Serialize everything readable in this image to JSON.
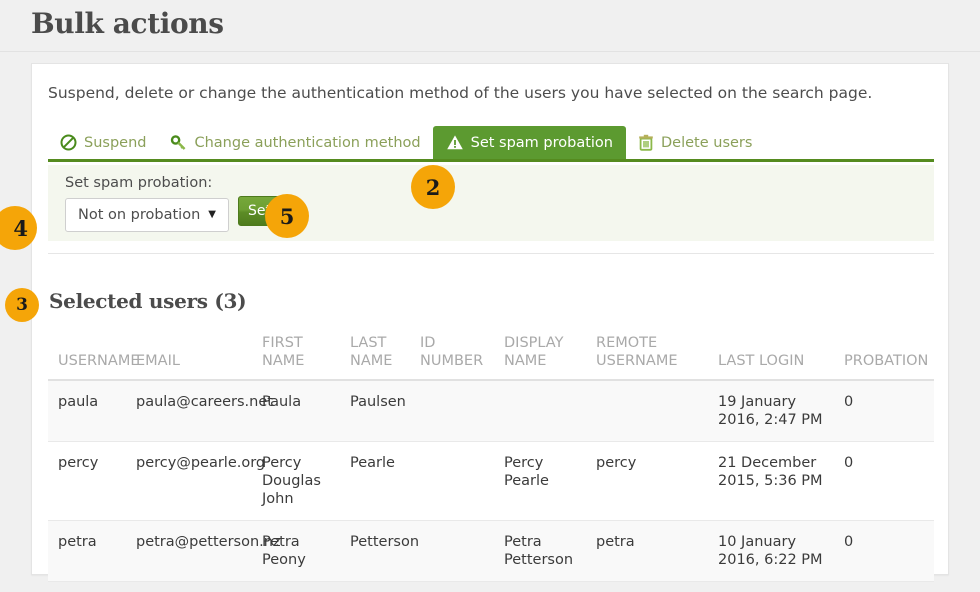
{
  "page": {
    "title": "Bulk actions"
  },
  "card": {
    "intro": "Suspend, delete or change the authentication method of the users you have selected on the search page."
  },
  "tabs": [
    {
      "label": "Suspend",
      "icon": "ban-icon",
      "active": false
    },
    {
      "label": "Change authentication method",
      "icon": "key-icon",
      "active": false
    },
    {
      "label": "Set spam probation",
      "icon": "warning-triangle-icon",
      "active": true
    },
    {
      "label": "Delete users",
      "icon": "trash-icon",
      "active": false
    }
  ],
  "form": {
    "label": "Set spam probation:",
    "select_value": "Not on probation",
    "select_options": [
      "Not on probation"
    ],
    "submit_label": "Set"
  },
  "selected_users": {
    "heading": "Selected users (3)",
    "columns": [
      "USERNAME",
      "EMAIL",
      "FIRST NAME",
      "LAST NAME",
      "ID NUMBER",
      "DISPLAY NAME",
      "REMOTE USERNAME",
      "LAST LOGIN",
      "PROBATION"
    ],
    "rows": [
      {
        "username": "paula",
        "email": "paula@careers.net",
        "first_name": "Paula",
        "last_name": "Paulsen",
        "id_number": "",
        "display_name": "",
        "remote_username": "",
        "last_login": "19 January 2016, 2:47 PM",
        "probation": "0"
      },
      {
        "username": "percy",
        "email": "percy@pearle.org",
        "first_name": "Percy Douglas John",
        "last_name": "Pearle",
        "id_number": "",
        "display_name": "Percy Pearle",
        "remote_username": "percy",
        "last_login": "21 December 2015, 5:36 PM",
        "probation": "0"
      },
      {
        "username": "petra",
        "email": "petra@petterson.nz",
        "first_name": "Petra Peony",
        "last_name": "Petterson",
        "id_number": "",
        "display_name": "Petra Petterson",
        "remote_username": "petra",
        "last_login": "10 January 2016, 6:22 PM",
        "probation": "0"
      }
    ]
  },
  "callouts": [
    {
      "number": "2"
    },
    {
      "number": "3"
    },
    {
      "number": "4"
    },
    {
      "number": "5"
    }
  ],
  "colors": {
    "accent_green": "#558b1f",
    "tab_active_bg": "#5c9a30",
    "tab_inactive_text": "#8ba05a",
    "strip_bg": "#f4f7ee",
    "badge_orange": "#f5a508",
    "page_bg": "#f0f0f0"
  }
}
